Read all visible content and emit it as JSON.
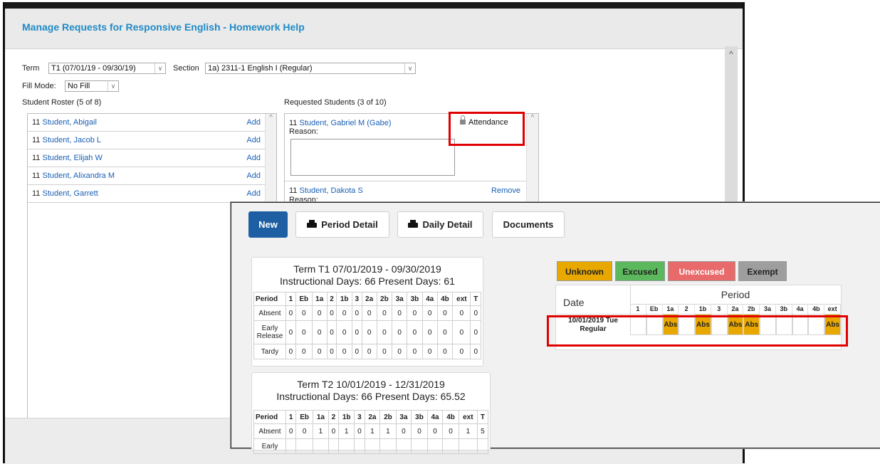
{
  "main": {
    "title": "Manage Requests for Responsive English - Homework Help",
    "term_label": "Term",
    "term_value": "T1 (07/01/19 - 09/30/19)",
    "section_label": "Section",
    "section_value": "1a) 2311-1 English I (Regular)",
    "fill_mode_label": "Fill Mode:",
    "fill_mode_value": "No Fill",
    "roster_header": "Student Roster (5 of 8)",
    "roster": [
      {
        "grade": "11",
        "name": "Student, Abigail",
        "action": "Add"
      },
      {
        "grade": "11",
        "name": "Student, Jacob L",
        "action": "Add"
      },
      {
        "grade": "11",
        "name": "Student, Elijah W",
        "action": "Add"
      },
      {
        "grade": "11",
        "name": "Student, Alixandra M",
        "action": "Add"
      },
      {
        "grade": "11",
        "name": "Student, Garrett",
        "action": "Add"
      }
    ],
    "requested_header": "Requested Students (3 of 10)",
    "requested": [
      {
        "grade": "11",
        "name": "Student, Gabriel M (Gabe)",
        "reason_label": "Reason:",
        "action": "Attendance"
      },
      {
        "grade": "11",
        "name": "Student, Dakota S",
        "reason_label": "Reason:",
        "action": "Remove"
      }
    ]
  },
  "attendance": {
    "buttons": {
      "new": "New",
      "period_detail": "Period Detail",
      "daily_detail": "Daily Detail",
      "documents": "Documents"
    },
    "term1": {
      "title": "Term T1 07/01/2019 - 09/30/2019",
      "days": "Instructional Days: 66   Present Days: 61",
      "headers": [
        "Period",
        "1",
        "Eb",
        "1a",
        "2",
        "1b",
        "3",
        "2a",
        "2b",
        "3a",
        "3b",
        "4a",
        "4b",
        "ext",
        "T"
      ],
      "rows": [
        {
          "label": "Absent",
          "values": [
            "0",
            "0",
            "0",
            "0",
            "0",
            "0",
            "0",
            "0",
            "0",
            "0",
            "0",
            "0",
            "0",
            "0"
          ]
        },
        {
          "label": "Early Release",
          "values": [
            "0",
            "0",
            "0",
            "0",
            "0",
            "0",
            "0",
            "0",
            "0",
            "0",
            "0",
            "0",
            "0",
            "0"
          ]
        },
        {
          "label": "Tardy",
          "values": [
            "0",
            "0",
            "0",
            "0",
            "0",
            "0",
            "0",
            "0",
            "0",
            "0",
            "0",
            "0",
            "0",
            "0"
          ]
        }
      ]
    },
    "term2": {
      "title": "Term T2 10/01/2019 - 12/31/2019",
      "days": "Instructional Days: 66   Present Days: 65.52",
      "headers": [
        "Period",
        "1",
        "Eb",
        "1a",
        "2",
        "1b",
        "3",
        "2a",
        "2b",
        "3a",
        "3b",
        "4a",
        "4b",
        "ext",
        "T"
      ],
      "rows": [
        {
          "label": "Absent",
          "values": [
            "0",
            "0",
            "1",
            "0",
            "1",
            "0",
            "1",
            "1",
            "0",
            "0",
            "0",
            "0",
            "1",
            "5"
          ]
        },
        {
          "label": "Early",
          "values": [
            "",
            "",
            "",
            "",
            "",
            "",
            "",
            "",
            "",
            "",
            "",
            "",
            "",
            ""
          ]
        }
      ]
    },
    "legend": {
      "unknown": "Unknown",
      "excused": "Excused",
      "unexcused": "Unexcused",
      "exempt": "Exempt"
    },
    "colors": {
      "unknown": "#e9a800",
      "excused": "#5cb85c",
      "unexcused": "#e86a6a",
      "exempt": "#9e9e9e"
    },
    "grid": {
      "date_header": "Date",
      "period_header": "Period",
      "periods": [
        "1",
        "Eb",
        "1a",
        "2",
        "1b",
        "3",
        "2a",
        "2b",
        "3a",
        "3b",
        "4a",
        "4b",
        "ext"
      ],
      "row_date": "10/01/2019 Tue",
      "row_type": "Regular",
      "cells": [
        "",
        "",
        "Abs",
        "",
        "Abs",
        "",
        "Abs",
        "Abs",
        "",
        "",
        "",
        "",
        "Abs"
      ]
    }
  }
}
